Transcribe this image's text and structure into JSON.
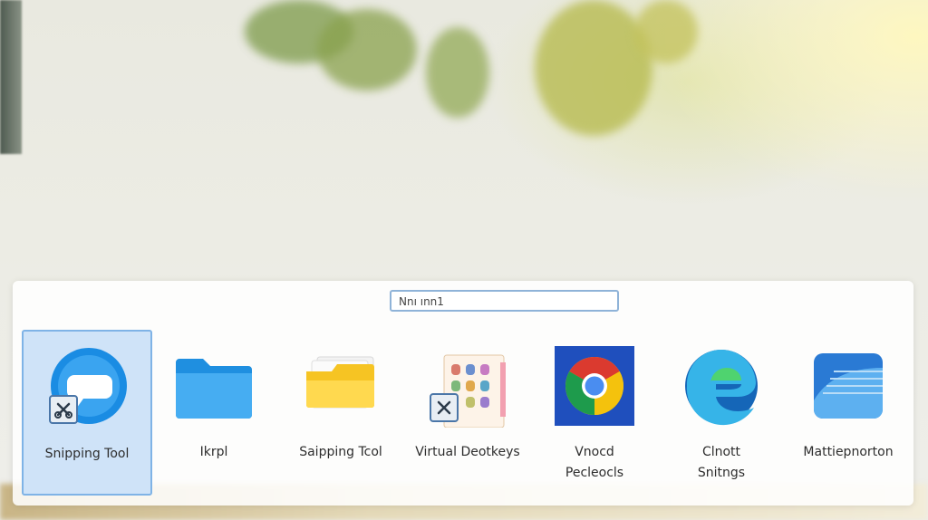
{
  "search": {
    "value": "Nnı ınn1"
  },
  "apps": [
    {
      "name": "Snipping Tool",
      "icon": "snipping-tool-icon",
      "selected": true
    },
    {
      "name": "Ikrpl",
      "icon": "folder-icon",
      "selected": false
    },
    {
      "name": "Saipping Tcol",
      "icon": "file-explorer-icon",
      "selected": false
    },
    {
      "name": "Virtual Deotkeys",
      "icon": "virtual-desktops-icon",
      "selected": false
    },
    {
      "name_line1": "Vnocd",
      "name_line2": "Pecleocls",
      "icon": "chrome-icon",
      "selected": false
    },
    {
      "name_line1": "Clnott",
      "name_line2": "Snitngs",
      "icon": "edge-icon",
      "selected": false
    },
    {
      "name": "Mattiepnorton",
      "icon": "blue-app-icon",
      "selected": false
    }
  ],
  "colors": {
    "selection_fill": "#cfe3f8",
    "selection_border": "#7fb3e6",
    "search_border": "#8fb3d8"
  }
}
